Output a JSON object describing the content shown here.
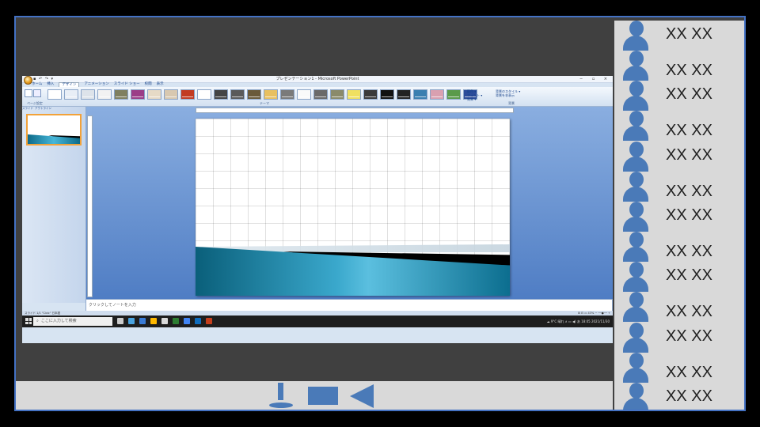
{
  "window": {
    "title": "プレゼンテーション1 - Microsoft PowerPoint",
    "controls": "− ▫ ×"
  },
  "qat_text": "▪ ↶ ↷ ▾",
  "ribbon": {
    "tabs": [
      "ホーム",
      "挿入",
      "デザイン",
      "アニメーション",
      "スライド ショー",
      "校閲",
      "表示"
    ],
    "active_tab": "デザイン",
    "groups": {
      "page_setup": "ページ設定",
      "themes": "テーマ",
      "background": "背景"
    },
    "theme_colors": [
      "#ffffff",
      "#e8eef6",
      "#dde3ea",
      "#f2f2f2",
      "#7f7f5f",
      "#9b3d87",
      "#e6dac6",
      "#d8c8b0",
      "#c23b22",
      "#ffffff",
      "#444444",
      "#5a5a5a",
      "#6a5a3a",
      "#e8c060",
      "#7a7a7a",
      "#fafafa",
      "#6a6a6a",
      "#8a8a6a",
      "#f0e060",
      "#3a3a3a",
      "#111111",
      "#222222",
      "#3a7fb0",
      "#d9a0b0",
      "#5a9a4a",
      "#2c4c9a"
    ],
    "controls": [
      "配色 ▾",
      "フォント ▾",
      "効果 ▾"
    ],
    "background_controls": [
      "背景のスタイル ▾",
      "背景を非表示"
    ]
  },
  "left_pane": {
    "tabs": [
      "スライド",
      "アウトライン"
    ]
  },
  "notes_placeholder": "クリックしてノートを入力",
  "status": {
    "left": "スライド 1/1   \"Civic\"   日本語",
    "right": "⊞ ⊟ ▭  43%  − ──●── +"
  },
  "taskbar": {
    "search_placeholder": "ここに入力して検索",
    "icon_colors": [
      "#cccccc",
      "#4aa3df",
      "#3a7bd5",
      "#ffb900",
      "#d9d9d9",
      "#2d7d32",
      "#4285f4",
      "#0f6cbd",
      "#c43e1c"
    ],
    "tray": "☁ 9°C  晴れ  ∧ ▭ ◀) あ  18:05  2021/11/30"
  },
  "participants": [
    {
      "name": "XX XX"
    },
    {
      "name": "XX XX"
    },
    {
      "name": "XX XX"
    },
    {
      "name": "XX XX"
    },
    {
      "name": "XX XX"
    },
    {
      "name": "XX XX"
    },
    {
      "name": "XX XX"
    },
    {
      "name": "XX XX"
    },
    {
      "name": "XX XX"
    },
    {
      "name": "XX XX"
    },
    {
      "name": "XX XX"
    },
    {
      "name": "XX XX"
    },
    {
      "name": "XX XX"
    }
  ],
  "colors": {
    "accent": "#4a7ab8",
    "frame_border": "#4472c4",
    "slide_teal": "#3aa8cc"
  }
}
